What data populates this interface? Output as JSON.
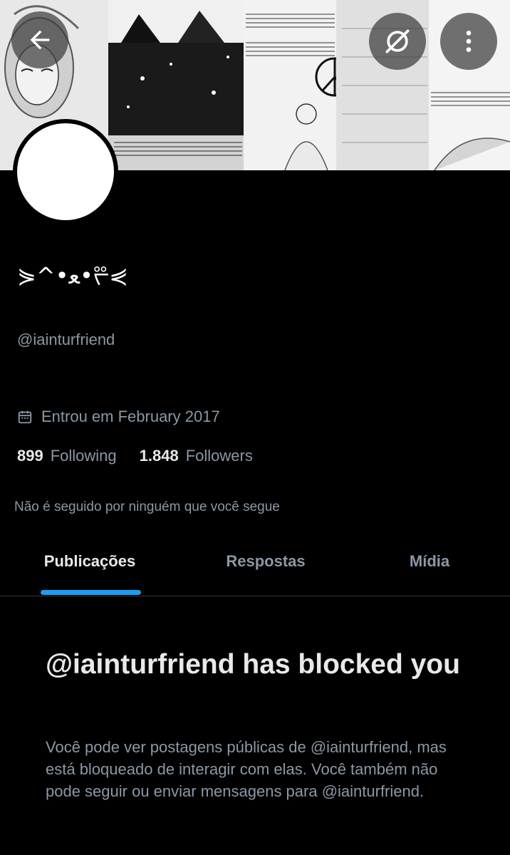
{
  "colors": {
    "background": "#000000",
    "text_primary": "#e7e9ea",
    "text_secondary": "#8b98a5",
    "accent": "#1d9bf0",
    "divider": "#2f3336"
  },
  "header": {
    "back_icon": "arrow-left-icon",
    "block_icon": "block-slash-icon",
    "more_icon": "more-vertical-icon"
  },
  "profile": {
    "display_name": "⋟^•ﻌ•ᢟ⋞",
    "handle": "@iainturfriend",
    "joined_icon": "calendar-icon",
    "joined": "Entrou em February 2017",
    "following_count": "899",
    "following_label": "Following",
    "followers_count": "1.848",
    "followers_label": "Followers",
    "followed_by": "Não é seguido por ninguém que você segue"
  },
  "tabs": [
    {
      "label": "Publicações",
      "active": true
    },
    {
      "label": "Respostas",
      "active": false
    },
    {
      "label": "Mídia",
      "active": false
    }
  ],
  "blocked": {
    "title": "@iainturfriend has blocked you",
    "message": "Você pode ver postagens públicas de @iainturfriend, mas está bloqueado de interagir com elas. Você também não pode seguir ou enviar mensagens para @iainturfriend."
  }
}
